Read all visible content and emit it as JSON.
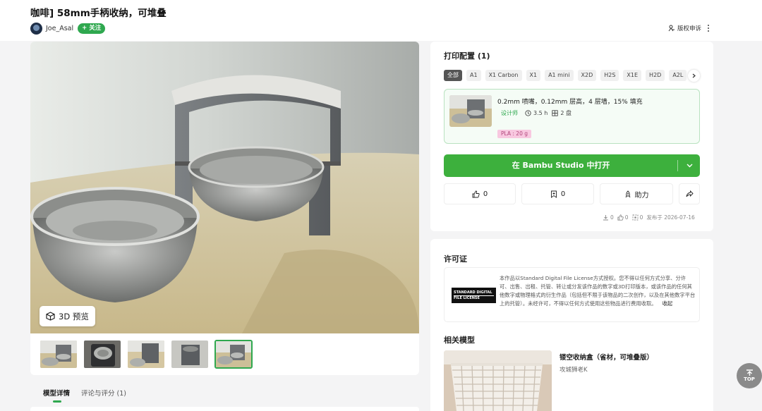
{
  "model": {
    "title": "咖啡] 58mm手柄收纳，可堆叠",
    "author": "Joe_Asal",
    "follow_label": "+ 关注",
    "report_label": "版权申诉"
  },
  "gallery": {
    "preview_label": "3D 预览",
    "thumbnails": 5,
    "active_thumbnail": 5
  },
  "detail_tabs": [
    {
      "label": "模型详情",
      "active": true
    },
    {
      "label": "评论与评分 (1)",
      "active": false
    }
  ],
  "print_profiles": {
    "title": "打印配置 (1)",
    "printer_filters": [
      "全部",
      "A1",
      "X1 Carbon",
      "X1",
      "A1 mini",
      "X2D",
      "H2S",
      "X1E",
      "H2D",
      "A2L"
    ],
    "active_filter": "全部",
    "profile": {
      "description": "0.2mm 喷嘴，0.12mm 层高，4 层墙，15% 填充",
      "role": "设计师",
      "time": "3.5 h",
      "plates": "2 盘",
      "material": "PLA : 20 g"
    },
    "open_label": "在 Bambu Studio 中打开"
  },
  "actions": {
    "likes": "0",
    "collects": "0",
    "boost_label": "助力"
  },
  "stats": {
    "downloads": "0",
    "likes": "0",
    "prints": "0",
    "published": "发布于 2026-07-16"
  },
  "license": {
    "title": "许可证",
    "logo_line1": "STANDARD DIGITAL",
    "logo_line2": "FILE LICENSE",
    "text": "本作品以Standard Digital File License方式授权。您不得以任何方式分享、分许可、出售、出租、托管、转让或分发该作品的数字或3D打印版本，或该作品的任何其他数字或物理格式的衍生作品（包括但不限于该物品的二次创作，以及在其他数字平台上的托管）。未经许可，不得以任何方式使用这些物品进行费用收取。",
    "collapse_label": "收起"
  },
  "related": {
    "title": "相关模型",
    "name": "镂空收纳盒（省材，可堆叠版）",
    "author": "攻城狮老K"
  },
  "back_to_top": "TOP",
  "colors": {
    "accent": "#3db03d",
    "profile_border": "#b9e2c0",
    "material_tag": "#f8c8e0"
  }
}
